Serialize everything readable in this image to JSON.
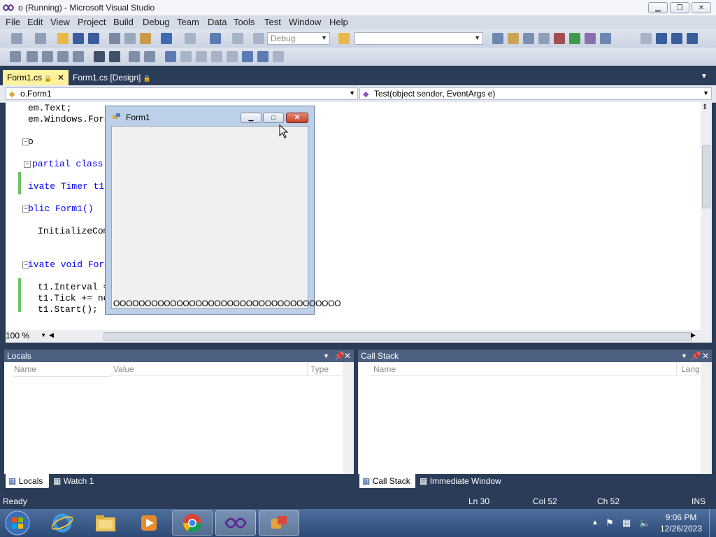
{
  "window": {
    "title": "o (Running) - Microsoft Visual Studio"
  },
  "menu": [
    "File",
    "Edit",
    "View",
    "Project",
    "Build",
    "Debug",
    "Team",
    "Data",
    "Tools",
    "Test",
    "Window",
    "Help"
  ],
  "toolbar": {
    "config": "Debug",
    "platform": ""
  },
  "tabs": [
    {
      "label": "Form1.cs",
      "active": true
    },
    {
      "label": "Form1.cs [Design]",
      "active": false
    }
  ],
  "nav": {
    "class_combo": "o.Form1",
    "member_combo": "Test(object sender, EventArgs e)"
  },
  "code_lines": [
    "em.Text;",
    "em.Windows.Forms;",
    "o",
    "partial class F",
    "ivate Timer t1 =",
    "blic Form1()",
    "InitializeComp",
    "ivate void Form1",
    "t1.Interval =",
    "t1.Tick += new",
    "t1.Start();"
  ],
  "zoom": "100 %",
  "form1": {
    "title": "Form1",
    "label": "OOOOOOOOOOOOOOOOOOOOOOOOOOOOOOOOOOOO"
  },
  "locals": {
    "title": "Locals",
    "col_name": "Name",
    "col_value": "Value",
    "col_type": "Type",
    "tab1": "Locals",
    "tab2": "Watch 1"
  },
  "callstack": {
    "title": "Call Stack",
    "col_name": "Name",
    "col_lang": "Lang",
    "tab1": "Call Stack",
    "tab2": "Immediate Window"
  },
  "status": {
    "ready": "Ready",
    "ln": "Ln 30",
    "col": "Col 52",
    "ch": "Ch 52",
    "ins": "INS"
  },
  "clock": {
    "time": "9:06 PM",
    "date": "12/26/2023"
  },
  "colors": {
    "accent": "#2b3c59",
    "tab_active": "#fff29d",
    "gutter_changed": "#6cc263"
  }
}
